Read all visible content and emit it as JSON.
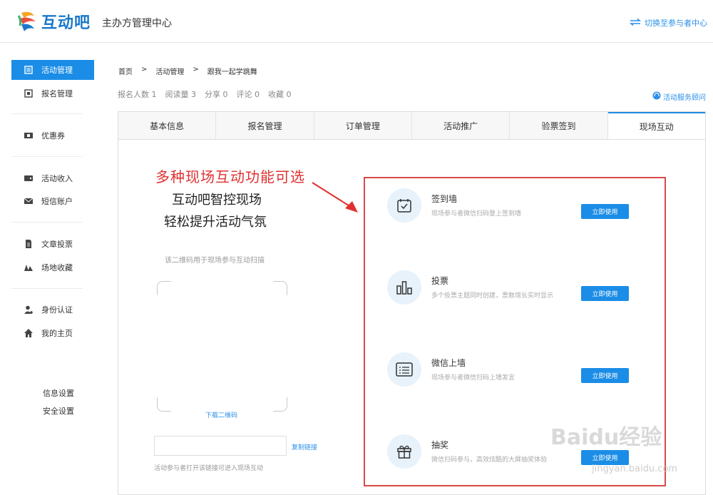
{
  "header": {
    "logo_text": "互动吧",
    "center_title": "主办方管理中心",
    "switch_label": "切换至参与者中心"
  },
  "sidebar": {
    "items": [
      {
        "label": "活动管理",
        "icon": "list-icon",
        "active": true
      },
      {
        "label": "报名管理",
        "icon": "form-icon"
      },
      {
        "label": "优惠券",
        "icon": "coupon-icon"
      },
      {
        "label": "活动收入",
        "icon": "wallet-icon"
      },
      {
        "label": "短信账户",
        "icon": "mail-icon"
      },
      {
        "label": "文章投票",
        "icon": "document-icon"
      },
      {
        "label": "场地收藏",
        "icon": "venue-icon"
      },
      {
        "label": "身份认证",
        "icon": "user-verify-icon"
      },
      {
        "label": "我的主页",
        "icon": "home-icon"
      }
    ],
    "settings": [
      "信息设置",
      "安全设置"
    ]
  },
  "breadcrumb": {
    "home": "首页",
    "sep": ">",
    "section": "活动管理",
    "current": "跟我一起学跳舞"
  },
  "stats": [
    "报名人数 1",
    "阅读量 3",
    "分享 0",
    "评论 0",
    "收藏 0"
  ],
  "service_label": "活动服务顾问",
  "tabs": [
    "基本信息",
    "报名管理",
    "订单管理",
    "活动推广",
    "验票签到",
    "现场互动"
  ],
  "annotation": "多种现场互动功能可选",
  "hero": {
    "line1": "互动吧智控现场",
    "line2": "轻松提升活动气氛"
  },
  "qr": {
    "hint": "该二维码用于现场参与互动扫描",
    "download": "下载二维码",
    "copy_link": "复制链接",
    "link_hint": "活动参与者打开该链接可进入现场互动"
  },
  "features": [
    {
      "name": "签到墙",
      "desc": "现场参与者微信扫码登上签到墙",
      "button": "立即使用",
      "icon": "calendar-check-icon"
    },
    {
      "name": "投票",
      "desc": "多个投票主题同时创建，票数增长实时显示",
      "button": "立即使用",
      "icon": "bar-chart-icon"
    },
    {
      "name": "微信上墙",
      "desc": "现场参与者微信扫码上墙发言",
      "button": "立即使用",
      "icon": "message-wall-icon"
    },
    {
      "name": "抽奖",
      "desc": "微信扫码参与，高效炫酷的大屏抽奖体验",
      "button": "立即使用",
      "icon": "gift-icon"
    }
  ],
  "watermark": {
    "main": "Baidu经验",
    "sub": "jingyan.baidu.com"
  },
  "colors": {
    "accent": "#1b8de6",
    "annotation": "#e03030",
    "highlight_box": "#d94a4a"
  }
}
